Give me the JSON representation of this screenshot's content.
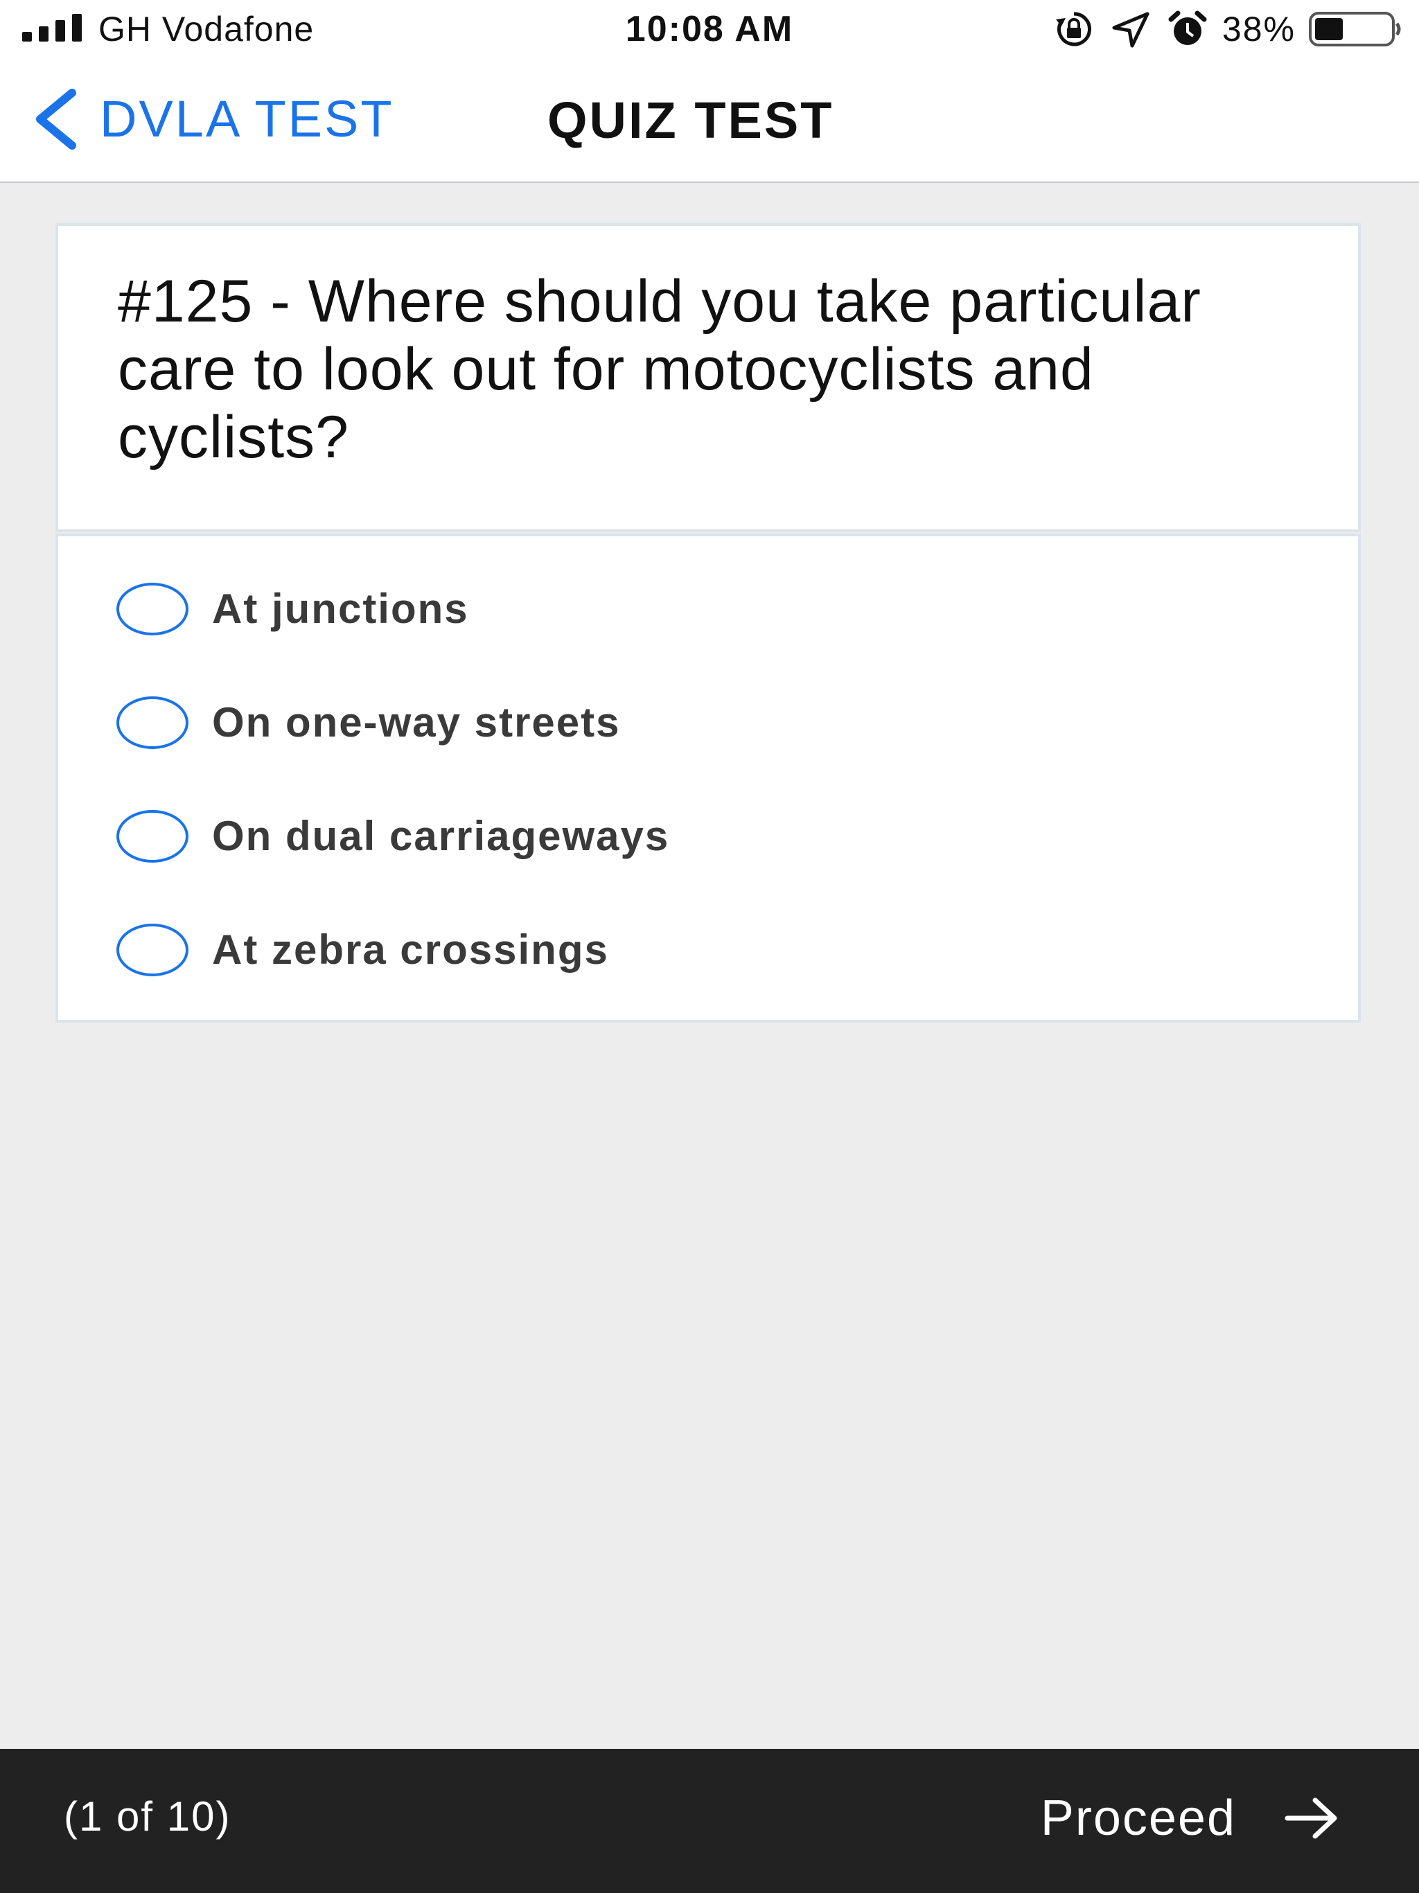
{
  "status_bar": {
    "carrier": "GH Vodafone",
    "time": "10:08 AM",
    "battery_percent": "38%",
    "battery_level": 0.38,
    "icons": [
      "signal-icon",
      "orientation-lock-icon",
      "location-icon",
      "alarm-icon",
      "battery-icon"
    ]
  },
  "nav": {
    "back_label": "DVLA TEST",
    "title": "QUIZ TEST"
  },
  "question": {
    "text": "#125 - Where should you take particular care to look out for motocyclists and cyclists?"
  },
  "options": [
    {
      "label": "At junctions",
      "selected": false
    },
    {
      "label": "On one-way streets",
      "selected": false
    },
    {
      "label": "On dual carriageways",
      "selected": false
    },
    {
      "label": "At zebra crossings",
      "selected": false
    }
  ],
  "footer": {
    "progress": "(1 of 10)",
    "proceed_label": "Proceed"
  },
  "colors": {
    "accent": "#1a73e8",
    "background": "#ededee",
    "footer": "#222222",
    "card_border": "#dde3ea"
  }
}
